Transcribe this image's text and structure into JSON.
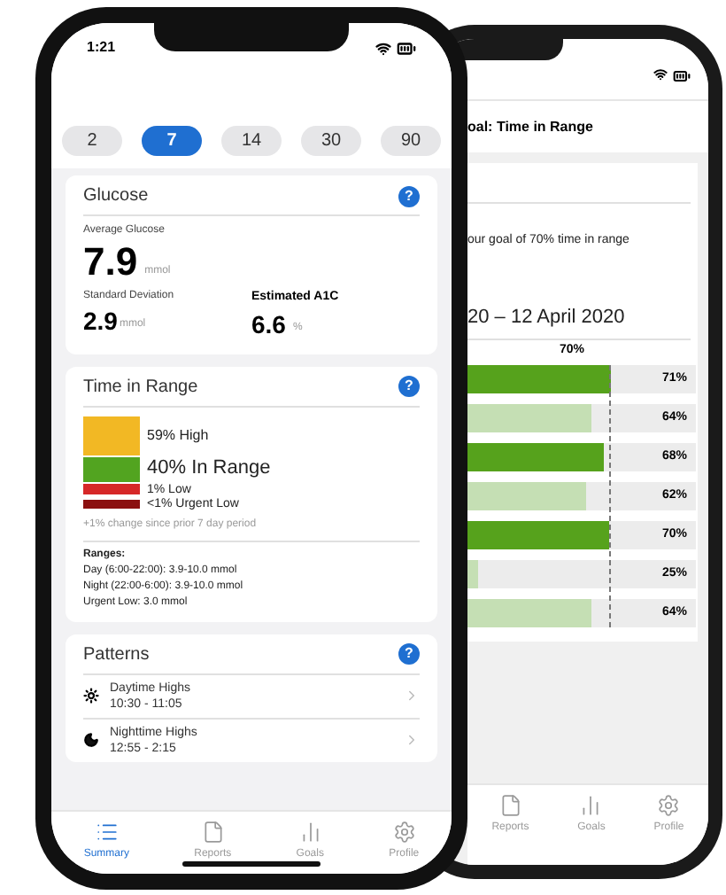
{
  "front_phone": {
    "status_bar": {
      "time": "1:21"
    },
    "periods": [
      {
        "label": "2",
        "selected": false
      },
      {
        "label": "7",
        "selected": true
      },
      {
        "label": "14",
        "selected": false
      },
      {
        "label": "30",
        "selected": false
      },
      {
        "label": "90",
        "selected": false
      }
    ],
    "glucose": {
      "title": "Glucose",
      "help": "?",
      "average_label": "Average Glucose",
      "average_value": "7.9",
      "average_unit": "mmol",
      "sd_label": "Standard Deviation",
      "sd_value": "2.9",
      "sd_unit": "mmol",
      "a1c_label": "Estimated A1C",
      "a1c_value": "6.6",
      "a1c_unit": "%"
    },
    "time_in_range": {
      "title": "Time in Range",
      "help": "?",
      "segments": [
        {
          "kind": "high",
          "label": "59% High",
          "color": "#f2b824"
        },
        {
          "kind": "in_range",
          "label": "40% In Range",
          "color": "#52a420"
        },
        {
          "kind": "low",
          "label": "1% Low",
          "color": "#d62828"
        },
        {
          "kind": "urgent_low",
          "label": "<1% Urgent Low",
          "color": "#8b1010"
        }
      ],
      "change_note": "+1% change since prior 7 day period",
      "ranges_title": "Ranges:",
      "ranges": [
        "Day (6:00-22:00): 3.9-10.0 mmol",
        "Night (22:00-6:00): 3.9-10.0 mmol",
        "Urgent Low: 3.0 mmol"
      ]
    },
    "patterns": {
      "title": "Patterns",
      "help": "?",
      "items": [
        {
          "kind": "day",
          "title": "Daytime Highs",
          "time": "10:30 - 11:05"
        },
        {
          "kind": "night",
          "title": "Nighttime Highs",
          "time": "12:55 - 2:15"
        }
      ]
    },
    "tabs": [
      {
        "kind": "summary",
        "label": "Summary",
        "selected": true
      },
      {
        "kind": "reports",
        "label": "Reports",
        "selected": false
      },
      {
        "kind": "goals",
        "label": "Goals",
        "selected": false
      },
      {
        "kind": "profile",
        "label": "Profile",
        "selected": false
      }
    ]
  },
  "back_phone": {
    "title": "oal: Time in Range",
    "goal_text": "our goal of 70% time in range",
    "date_range": "20 – 12 April 2020",
    "goal_marker": "70%",
    "rows": [
      {
        "reading": "71%",
        "level": 0.71,
        "met": true
      },
      {
        "reading": "64%",
        "level": 0.64,
        "met": false
      },
      {
        "reading": "68%",
        "level": 0.68,
        "met": true
      },
      {
        "reading": "62%",
        "level": 0.62,
        "met": false
      },
      {
        "reading": "70%",
        "level": 0.7,
        "met": true
      },
      {
        "reading": "25%",
        "level": 0.25,
        "met": false
      },
      {
        "reading": "64%",
        "level": 0.64,
        "met": false
      }
    ],
    "tabs": [
      {
        "kind": "reports",
        "label": "Reports",
        "selected": false
      },
      {
        "kind": "goals",
        "label": "Goals",
        "selected": false
      },
      {
        "kind": "profile",
        "label": "Profile",
        "selected": false
      }
    ]
  }
}
